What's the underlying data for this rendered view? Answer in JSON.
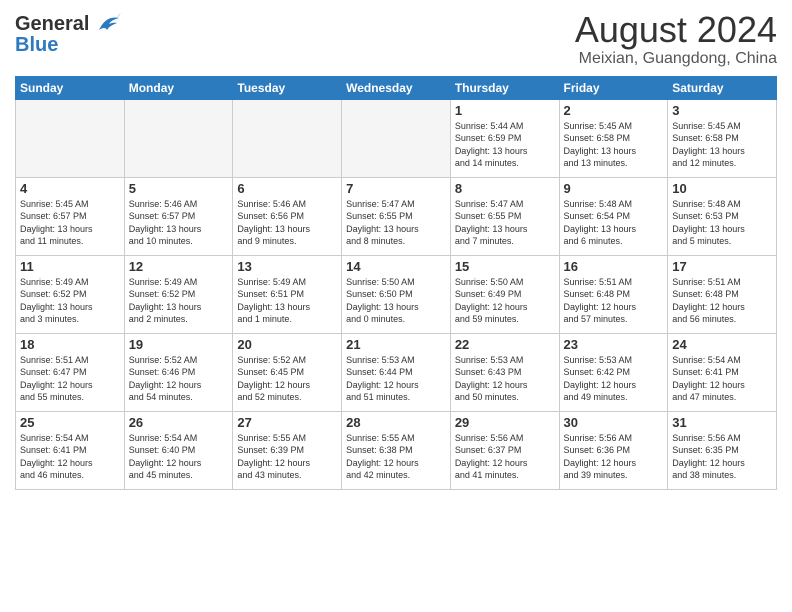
{
  "logo": {
    "line1": "General",
    "line2": "Blue"
  },
  "title": "August 2024",
  "location": "Meixian, Guangdong, China",
  "days_of_week": [
    "Sunday",
    "Monday",
    "Tuesday",
    "Wednesday",
    "Thursday",
    "Friday",
    "Saturday"
  ],
  "weeks": [
    [
      {
        "day": "",
        "info": ""
      },
      {
        "day": "",
        "info": ""
      },
      {
        "day": "",
        "info": ""
      },
      {
        "day": "",
        "info": ""
      },
      {
        "day": "1",
        "info": "Sunrise: 5:44 AM\nSunset: 6:59 PM\nDaylight: 13 hours\nand 14 minutes."
      },
      {
        "day": "2",
        "info": "Sunrise: 5:45 AM\nSunset: 6:58 PM\nDaylight: 13 hours\nand 13 minutes."
      },
      {
        "day": "3",
        "info": "Sunrise: 5:45 AM\nSunset: 6:58 PM\nDaylight: 13 hours\nand 12 minutes."
      }
    ],
    [
      {
        "day": "4",
        "info": "Sunrise: 5:45 AM\nSunset: 6:57 PM\nDaylight: 13 hours\nand 11 minutes."
      },
      {
        "day": "5",
        "info": "Sunrise: 5:46 AM\nSunset: 6:57 PM\nDaylight: 13 hours\nand 10 minutes."
      },
      {
        "day": "6",
        "info": "Sunrise: 5:46 AM\nSunset: 6:56 PM\nDaylight: 13 hours\nand 9 minutes."
      },
      {
        "day": "7",
        "info": "Sunrise: 5:47 AM\nSunset: 6:55 PM\nDaylight: 13 hours\nand 8 minutes."
      },
      {
        "day": "8",
        "info": "Sunrise: 5:47 AM\nSunset: 6:55 PM\nDaylight: 13 hours\nand 7 minutes."
      },
      {
        "day": "9",
        "info": "Sunrise: 5:48 AM\nSunset: 6:54 PM\nDaylight: 13 hours\nand 6 minutes."
      },
      {
        "day": "10",
        "info": "Sunrise: 5:48 AM\nSunset: 6:53 PM\nDaylight: 13 hours\nand 5 minutes."
      }
    ],
    [
      {
        "day": "11",
        "info": "Sunrise: 5:49 AM\nSunset: 6:52 PM\nDaylight: 13 hours\nand 3 minutes."
      },
      {
        "day": "12",
        "info": "Sunrise: 5:49 AM\nSunset: 6:52 PM\nDaylight: 13 hours\nand 2 minutes."
      },
      {
        "day": "13",
        "info": "Sunrise: 5:49 AM\nSunset: 6:51 PM\nDaylight: 13 hours\nand 1 minute."
      },
      {
        "day": "14",
        "info": "Sunrise: 5:50 AM\nSunset: 6:50 PM\nDaylight: 13 hours\nand 0 minutes."
      },
      {
        "day": "15",
        "info": "Sunrise: 5:50 AM\nSunset: 6:49 PM\nDaylight: 12 hours\nand 59 minutes."
      },
      {
        "day": "16",
        "info": "Sunrise: 5:51 AM\nSunset: 6:48 PM\nDaylight: 12 hours\nand 57 minutes."
      },
      {
        "day": "17",
        "info": "Sunrise: 5:51 AM\nSunset: 6:48 PM\nDaylight: 12 hours\nand 56 minutes."
      }
    ],
    [
      {
        "day": "18",
        "info": "Sunrise: 5:51 AM\nSunset: 6:47 PM\nDaylight: 12 hours\nand 55 minutes."
      },
      {
        "day": "19",
        "info": "Sunrise: 5:52 AM\nSunset: 6:46 PM\nDaylight: 12 hours\nand 54 minutes."
      },
      {
        "day": "20",
        "info": "Sunrise: 5:52 AM\nSunset: 6:45 PM\nDaylight: 12 hours\nand 52 minutes."
      },
      {
        "day": "21",
        "info": "Sunrise: 5:53 AM\nSunset: 6:44 PM\nDaylight: 12 hours\nand 51 minutes."
      },
      {
        "day": "22",
        "info": "Sunrise: 5:53 AM\nSunset: 6:43 PM\nDaylight: 12 hours\nand 50 minutes."
      },
      {
        "day": "23",
        "info": "Sunrise: 5:53 AM\nSunset: 6:42 PM\nDaylight: 12 hours\nand 49 minutes."
      },
      {
        "day": "24",
        "info": "Sunrise: 5:54 AM\nSunset: 6:41 PM\nDaylight: 12 hours\nand 47 minutes."
      }
    ],
    [
      {
        "day": "25",
        "info": "Sunrise: 5:54 AM\nSunset: 6:41 PM\nDaylight: 12 hours\nand 46 minutes."
      },
      {
        "day": "26",
        "info": "Sunrise: 5:54 AM\nSunset: 6:40 PM\nDaylight: 12 hours\nand 45 minutes."
      },
      {
        "day": "27",
        "info": "Sunrise: 5:55 AM\nSunset: 6:39 PM\nDaylight: 12 hours\nand 43 minutes."
      },
      {
        "day": "28",
        "info": "Sunrise: 5:55 AM\nSunset: 6:38 PM\nDaylight: 12 hours\nand 42 minutes."
      },
      {
        "day": "29",
        "info": "Sunrise: 5:56 AM\nSunset: 6:37 PM\nDaylight: 12 hours\nand 41 minutes."
      },
      {
        "day": "30",
        "info": "Sunrise: 5:56 AM\nSunset: 6:36 PM\nDaylight: 12 hours\nand 39 minutes."
      },
      {
        "day": "31",
        "info": "Sunrise: 5:56 AM\nSunset: 6:35 PM\nDaylight: 12 hours\nand 38 minutes."
      }
    ]
  ]
}
